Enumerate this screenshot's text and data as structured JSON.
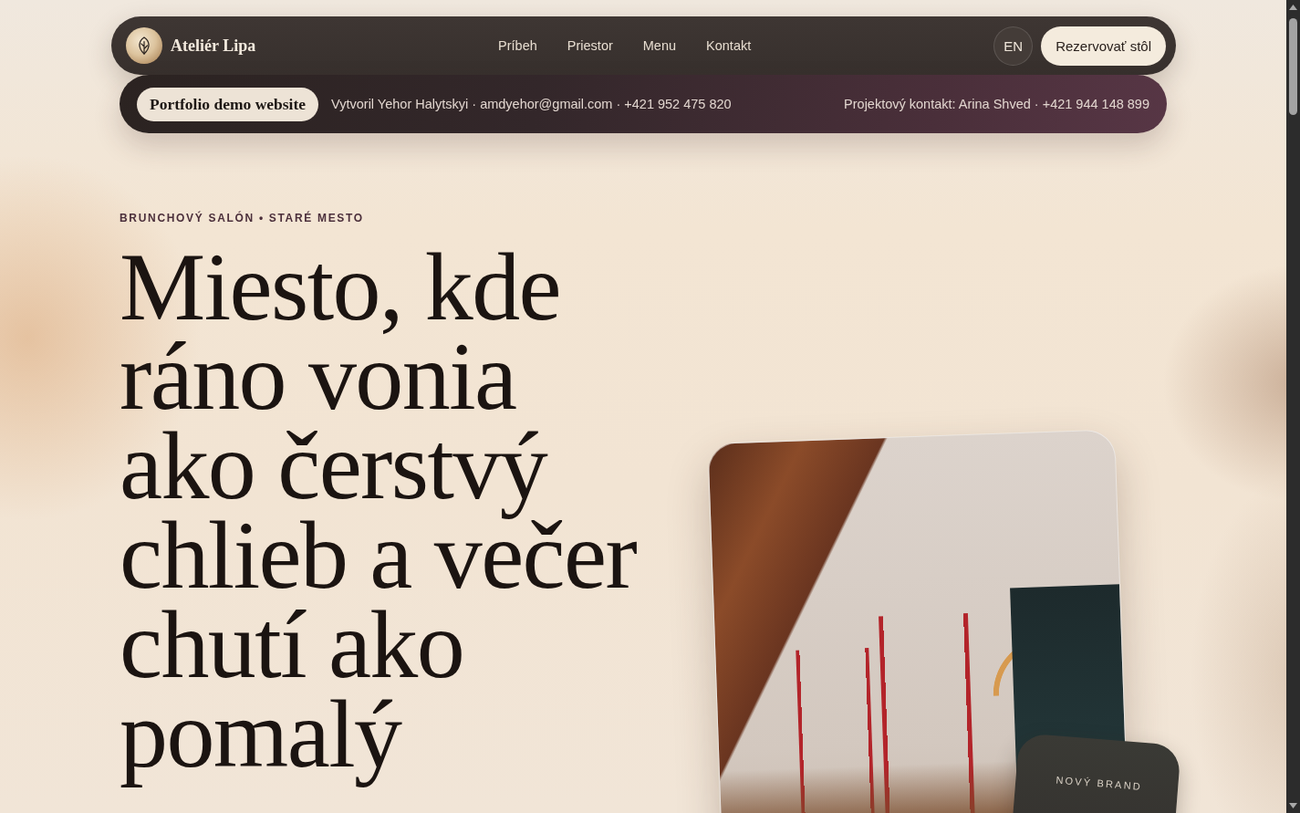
{
  "nav": {
    "brand": "Ateliér Lipa",
    "links": [
      "Príbeh",
      "Priestor",
      "Menu",
      "Kontakt"
    ],
    "language": "EN",
    "cta": "Rezervovať stôl"
  },
  "demo_bar": {
    "badge": "Portfolio demo website",
    "author": "Vytvoril Yehor Halytskyi · amdyehor@gmail.com · +421 952 475 820",
    "contact": "Projektový kontakt: Arina Shved · +421 944 148 899"
  },
  "hero": {
    "eyebrow": "BRUNCHOVÝ SALÓN • STARÉ MESTO",
    "headline_lines": [
      "Miesto, kde",
      "ráno vonia",
      "ako čerstvý",
      "chlieb a večer",
      "chutí ako",
      "pomalý"
    ],
    "brand_card": {
      "label": "NOVÝ BRAND"
    }
  }
}
